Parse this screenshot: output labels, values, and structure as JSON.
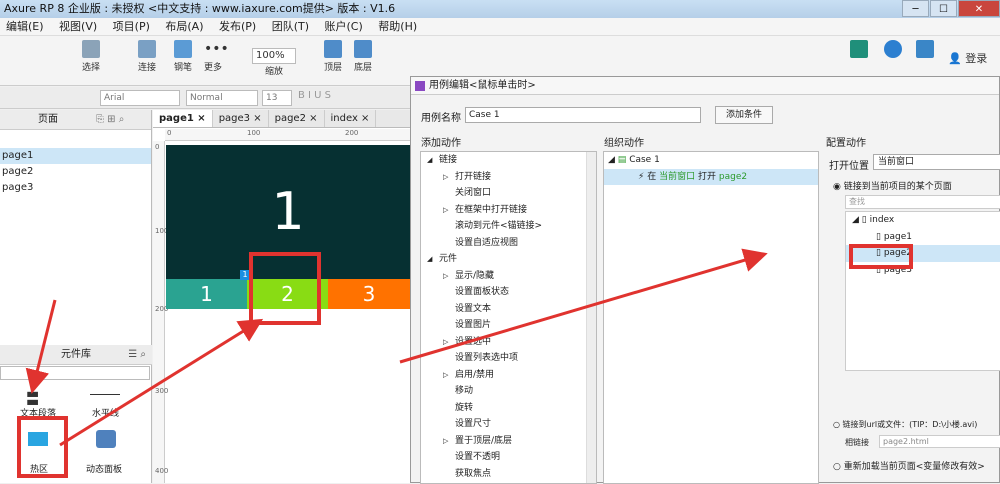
{
  "window": {
    "title": "Axure RP 8 企业版 : 未授权    <中文支持 : www.iaxure.com提供> 版本 : V1.6"
  },
  "menu": [
    "编辑(E)",
    "视图(V)",
    "项目(P)",
    "布局(A)",
    "发布(P)",
    "团队(T)",
    "账户(C)",
    "帮助(H)"
  ],
  "toolbar": {
    "items": [
      "选择",
      "连接",
      "钢笔",
      "更多",
      "缩放",
      "顶层",
      "底层"
    ],
    "zoom": "100%",
    "login": "登录"
  },
  "format": {
    "font": "Arial",
    "style": "Normal",
    "size": "13"
  },
  "pages_panel": {
    "title": "页面",
    "items": [
      "page1",
      "page2",
      "page3"
    ]
  },
  "tabs": [
    "page1",
    "page3",
    "page2",
    "index"
  ],
  "ruler": {
    "h": [
      "0",
      "100",
      "200"
    ],
    "v": [
      "0",
      "100",
      "200",
      "300",
      "400"
    ]
  },
  "canvas": {
    "big_label": "1",
    "nav": [
      "1",
      "2",
      "3"
    ],
    "badge": "1"
  },
  "library": {
    "title": "元件库",
    "items": [
      "文本段落",
      "水平线",
      "热区",
      "动态面板"
    ]
  },
  "dialog": {
    "title": "用例编辑<鼠标单击时>",
    "case_label": "用例名称",
    "case_name": "Case 1",
    "add_condition": "添加条件",
    "add_action_title": "添加动作",
    "organize_title": "组织动作",
    "configure_title": "配置动作",
    "actions": [
      {
        "label": "链接",
        "level": 0,
        "exp": "◢"
      },
      {
        "label": "打开链接",
        "level": 1,
        "exp": "▷"
      },
      {
        "label": "关闭窗口",
        "level": 1,
        "exp": ""
      },
      {
        "label": "在框架中打开链接",
        "level": 1,
        "exp": "▷"
      },
      {
        "label": "滚动到元件<锚链接>",
        "level": 1,
        "exp": ""
      },
      {
        "label": "设置自适应视图",
        "level": 1,
        "exp": ""
      },
      {
        "label": "元件",
        "level": 0,
        "exp": "◢"
      },
      {
        "label": "显示/隐藏",
        "level": 1,
        "exp": "▷"
      },
      {
        "label": "设置面板状态",
        "level": 1,
        "exp": ""
      },
      {
        "label": "设置文本",
        "level": 1,
        "exp": ""
      },
      {
        "label": "设置图片",
        "level": 1,
        "exp": ""
      },
      {
        "label": "设置选中",
        "level": 1,
        "exp": "▷"
      },
      {
        "label": "设置列表选中项",
        "level": 1,
        "exp": ""
      },
      {
        "label": "启用/禁用",
        "level": 1,
        "exp": "▷"
      },
      {
        "label": "移动",
        "level": 1,
        "exp": ""
      },
      {
        "label": "旋转",
        "level": 1,
        "exp": ""
      },
      {
        "label": "设置尺寸",
        "level": 1,
        "exp": ""
      },
      {
        "label": "置于顶层/底层",
        "level": 1,
        "exp": "▷"
      },
      {
        "label": "设置不透明",
        "level": 1,
        "exp": ""
      },
      {
        "label": "获取焦点",
        "level": 1,
        "exp": ""
      }
    ],
    "case_tree": {
      "case": "Case 1",
      "action_prefix": "在",
      "action_target": "当前窗口",
      "action_mid": "打开",
      "action_page": "page2"
    },
    "open_in_label": "打开位置",
    "open_in_value": "当前窗口",
    "radio_link": "链接到当前项目的某个页面",
    "search_placeholder": "查找",
    "tree": {
      "root": "index",
      "pages": [
        "page1",
        "page2",
        "page3"
      ]
    },
    "link_label": "链接到url或文件：(TIP：D:\\小楼.avi)",
    "url_label": "相链接",
    "url_value": "page2.html",
    "reload": "重新加载当前页面<变量修改有效>"
  },
  "colors": {
    "red": "#e0332f",
    "dark": "#063032",
    "teal": "#2aa391",
    "green": "#89dc14",
    "orange": "#ff7200",
    "link_green": "#2d9a2d"
  }
}
